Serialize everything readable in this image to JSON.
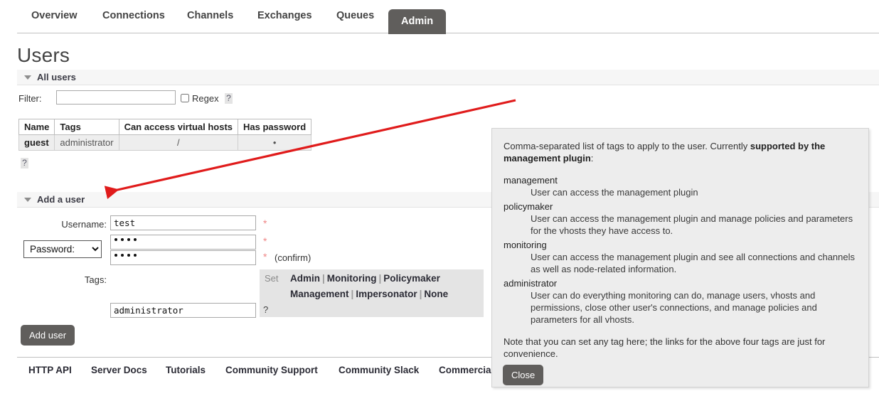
{
  "nav": {
    "tabs": [
      {
        "label": "Overview",
        "active": false
      },
      {
        "label": "Connections",
        "active": false
      },
      {
        "label": "Channels",
        "active": false
      },
      {
        "label": "Exchanges",
        "active": false
      },
      {
        "label": "Queues",
        "active": false
      },
      {
        "label": "Admin",
        "active": true
      }
    ]
  },
  "page": {
    "title": "Users"
  },
  "all_users_section": {
    "band_label": "All users",
    "filter_label": "Filter:",
    "filter_value": "",
    "regex_label": "Regex",
    "regex_checked": false,
    "regex_help": "?",
    "table_help": "?",
    "table": {
      "columns": [
        "Name",
        "Tags",
        "Can access virtual hosts",
        "Has password"
      ],
      "rows": [
        {
          "name": "guest",
          "tags": "administrator",
          "vhosts": "/",
          "has_password": "•"
        }
      ]
    }
  },
  "add_user_section": {
    "band_label": "Add a user",
    "username_label": "Username:",
    "username_value": "test",
    "password_select_label": "Password:",
    "password_value": "••••",
    "password_confirm_value": "••••",
    "confirm_note": "(confirm)",
    "required_marker": "*",
    "tags_label": "Tags:",
    "tags_value": "administrator",
    "tags_help": "?",
    "tags_set_word": "Set",
    "tag_links_row1": [
      "Admin",
      "Monitoring",
      "Policymaker"
    ],
    "tag_links_row2": [
      "Management",
      "Impersonator",
      "None"
    ],
    "tag_separator": "|",
    "add_user_button": "Add user"
  },
  "tooltip": {
    "intro_before": "Comma-separated list of tags to apply to the user. Currently ",
    "intro_bold": "supported by the management plugin",
    "intro_after": ":",
    "entries": [
      {
        "term": "management",
        "definition": "User can access the management plugin"
      },
      {
        "term": "policymaker",
        "definition": "User can access the management plugin and manage policies and parameters for the vhosts they have access to."
      },
      {
        "term": "monitoring",
        "definition": "User can access the management plugin and see all connections and channels as well as node-related information."
      },
      {
        "term": "administrator",
        "definition": "User can do everything monitoring can do, manage users, vhosts and permissions, close other user's connections, and manage policies and parameters for all vhosts."
      }
    ],
    "note": "Note that you can set any tag here; the links for the above four tags are just for convenience.",
    "close_button": "Close"
  },
  "footer": {
    "links": [
      "HTTP API",
      "Server Docs",
      "Tutorials",
      "Community Support",
      "Community Slack",
      "Commercial"
    ]
  },
  "annotation": {
    "arrow_color": "#e01b1b"
  }
}
